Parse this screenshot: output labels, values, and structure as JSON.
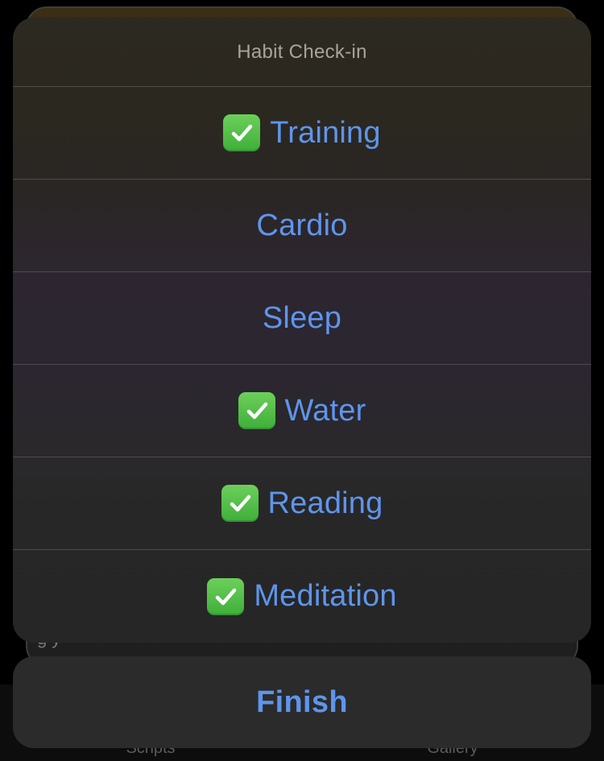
{
  "background": {
    "snippet_text": "g y",
    "tabs": [
      {
        "label": "Scripts"
      },
      {
        "label": "Gallery"
      }
    ]
  },
  "sheet": {
    "title": "Habit Check-in",
    "items": [
      {
        "label": "Training",
        "checked": true,
        "icon": "check-mark-button-icon"
      },
      {
        "label": "Cardio",
        "checked": false
      },
      {
        "label": "Sleep",
        "checked": false
      },
      {
        "label": "Water",
        "checked": true,
        "icon": "check-mark-button-icon"
      },
      {
        "label": "Reading",
        "checked": true,
        "icon": "check-mark-button-icon"
      },
      {
        "label": "Meditation",
        "checked": true,
        "icon": "check-mark-button-icon"
      }
    ]
  },
  "finish": {
    "label": "Finish"
  },
  "colors": {
    "accent": "#5e95ec",
    "check_green": "#4fbf44",
    "sheet_bg": "#2a2726",
    "finish_bg": "#2b2b2b",
    "title_text": "#a8a49c"
  }
}
